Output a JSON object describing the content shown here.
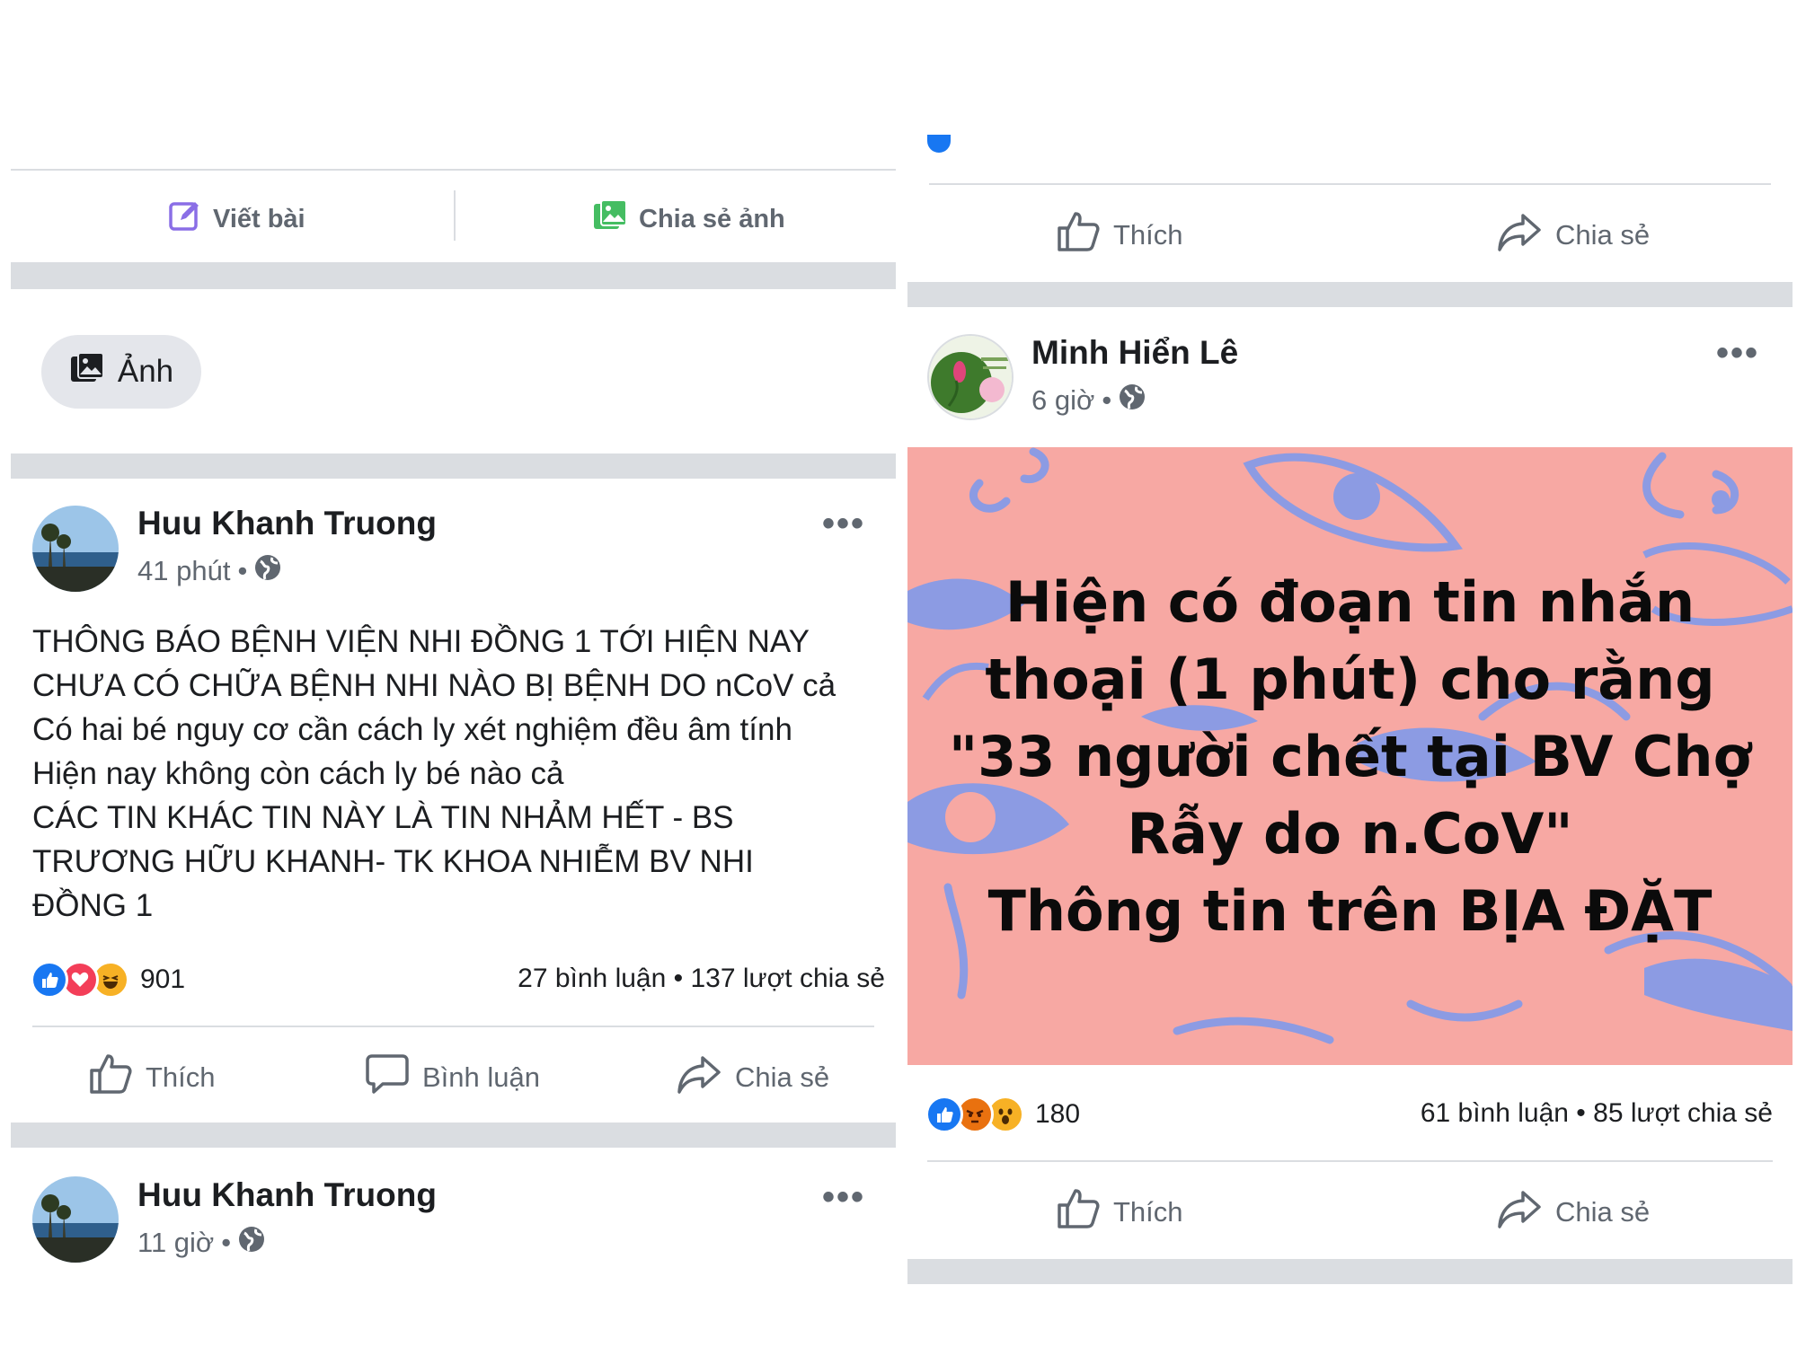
{
  "left": {
    "composer": {
      "write_label": "Viết bài",
      "share_photo_label": "Chia sẻ ảnh"
    },
    "photo_chip_label": "Ảnh",
    "post1": {
      "author": "Huu Khanh Truong",
      "time": "41 phút",
      "text_lines": [
        "THÔNG BÁO BỆNH VIỆN NHI ĐỒNG 1 TỚI HIỆN NAY",
        "CHƯA CÓ CHỮA BỆNH NHI NÀO BỊ BỆNH DO nCoV cả",
        "Có hai bé nguy cơ cần cách ly xét nghiệm đều âm tính",
        "Hiện nay không còn cách ly bé nào cả",
        "CÁC TIN KHÁC TIN NÀY LÀ TIN NHẢM HẾT - BS",
        "TRƯƠNG HỮU KHANH- TK KHOA NHIỄM BV NHI",
        "ĐỒNG 1"
      ],
      "reaction_count": "901",
      "stats": "27 bình luận • 137 lượt chia sẻ",
      "actions": {
        "like": "Thích",
        "comment": "Bình luận",
        "share": "Chia sẻ"
      }
    },
    "post2": {
      "author": "Huu Khanh Truong",
      "time": "11 giờ"
    }
  },
  "right": {
    "top_actions": {
      "like": "Thích",
      "share": "Chia sẻ"
    },
    "post": {
      "author": "Minh Hiển Lê",
      "time": "6 giờ",
      "image_text_lines": [
        "Hiện có đoạn tin nhắn",
        "thoại  (1 phút) cho rằng",
        "\"33 người chết tại BV Chợ",
        "Rẫy do n.CoV\"",
        "Thông tin trên BỊA ĐẶT"
      ],
      "reaction_count": "180",
      "stats": "61 bình luận • 85 lượt chia sẻ",
      "actions": {
        "like": "Thích",
        "share": "Chia sẻ"
      }
    }
  },
  "colors": {
    "text_secondary": "#606770",
    "separator": "#dadde1",
    "image_background": "#f7a8a3",
    "image_doodle": "#8c9be3",
    "like_blue": "#1877f2",
    "love_red": "#f33e58",
    "haha_yellow": "#f7b125",
    "angry_orange": "#e9710f"
  },
  "more_glyph": "•••"
}
